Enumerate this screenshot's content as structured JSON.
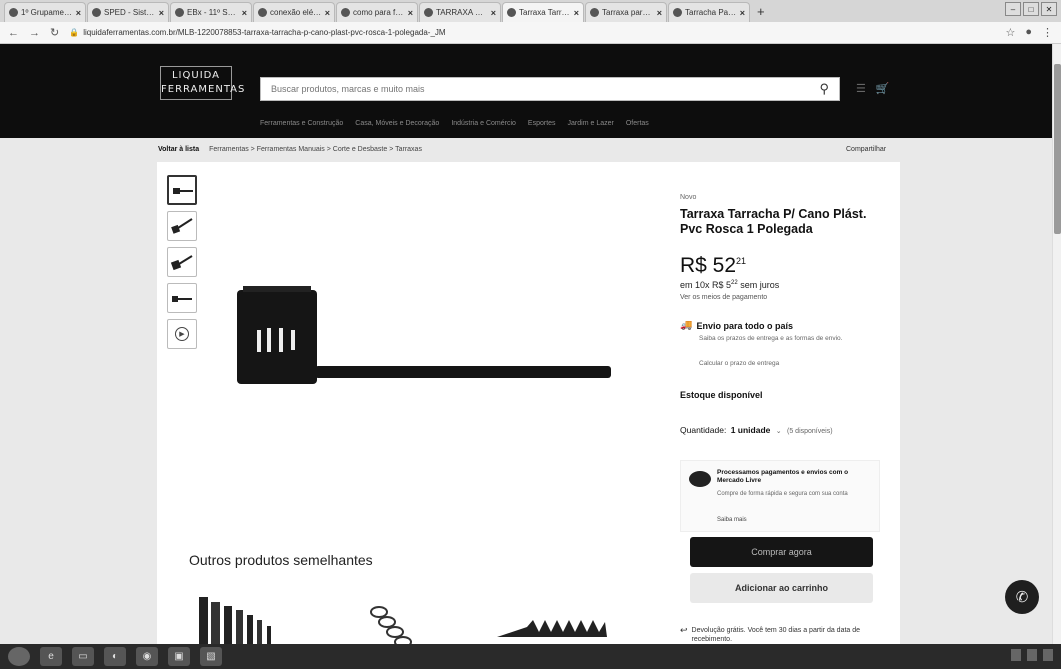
{
  "browser": {
    "tabs": [
      {
        "title": "1º Grupamento de",
        "active": false
      },
      {
        "title": "SPED - Sistema de",
        "active": false
      },
      {
        "title": "EBx - 11º SEGI",
        "active": false
      },
      {
        "title": "conexão elétrica",
        "active": false
      },
      {
        "title": "como para ferrame",
        "active": false
      },
      {
        "title": "TARRAXA COMBI",
        "active": false
      },
      {
        "title": "Tarraxa Tarracha",
        "active": true
      },
      {
        "title": "Tarraxa para Tubo",
        "active": false
      },
      {
        "title": "Tarracha Para Cano",
        "active": false
      }
    ],
    "url": "liquidaferramentas.com.br/MLB-1220078853-tarraxa-tarracha-p-cano-plast-pvc-rosca-1-polegada-_JM"
  },
  "header": {
    "logo_line1": "LIQUIDA",
    "logo_line2": "FERRAMENTAS",
    "search_placeholder": "Buscar produtos, marcas e muito mais",
    "categories": [
      "Ferramentas e Construção",
      "Casa, Móveis e Decoração",
      "Indústria e Comércio",
      "Esportes",
      "Jardim e Lazer",
      "Ofertas"
    ]
  },
  "breadcrumb": {
    "back": "Voltar à lista",
    "path": "Ferramentas > Ferramentas Manuais > Corte e Desbaste > Tarraxas",
    "share": "Compartilhar"
  },
  "product": {
    "condition": "Novo",
    "title": "Tarraxa Tarracha P/ Cano Plást. Pvc Rosca 1 Polegada",
    "price_main": "R$ 52",
    "price_cents": "21",
    "installments_prefix": "em 10x",
    "installments_value": "R$ 5",
    "installments_cents": "22",
    "installments_suffix": "sem juros",
    "payment_link": "Ver os meios de pagamento",
    "shipping_title": "Envio para todo o país",
    "shipping_sub": "Saiba os prazos de entrega e as formas de envio.",
    "shipping_calc": "Calcular o prazo de entrega",
    "stock": "Estoque disponível",
    "qty_label": "Quantidade:",
    "qty_value": "1 unidade",
    "qty_available": "(5 disponíveis)",
    "mp_title": "Processamos pagamentos e envios com o Mercado Livre",
    "mp_sub": "Compre de forma rápida e segura com sua conta",
    "mp_more": "Saiba mais",
    "buy_button": "Comprar agora",
    "cart_button": "Adicionar ao carrinho",
    "return_text": "Devolução grátis. Você tem 30 dias a partir da data de recebimento."
  },
  "similar": {
    "title": "Outros produtos semelhantes"
  }
}
